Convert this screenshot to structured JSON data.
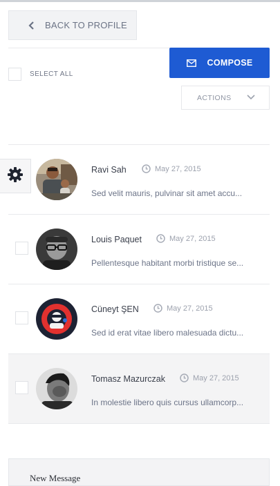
{
  "back": {
    "label": "BACK TO PROFILE",
    "icon": "chevron-left-icon"
  },
  "toolbar": {
    "select_all_label": "SELECT ALL",
    "compose_label": "COMPOSE",
    "compose_icon": "envelope-icon",
    "actions_label": "ACTIONS",
    "accent_color": "#1e5bd3"
  },
  "messages": [
    {
      "name": "Ravi Sah",
      "date": "May 27, 2015",
      "snippet": "Sed velit mauris, pulvinar sit amet accu...",
      "avatar": "photo-man-with-child"
    },
    {
      "name": "Louis Paquet",
      "date": "May 27, 2015",
      "snippet": "Pellentesque habitant morbi tristique se...",
      "avatar": "photo-man-glasses-bw"
    },
    {
      "name": "Cüneyt ŞEN",
      "date": "May 27, 2015",
      "snippet": "Sed id erat vitae libero malesuada dictu...",
      "avatar": "red-circle-logo"
    },
    {
      "name": "Tomasz Mazurczak",
      "date": "May 27, 2015",
      "snippet": "In molestie libero quis cursus ullamcorp...",
      "avatar": "photo-man-bw"
    }
  ],
  "settings_icon": "gear-icon",
  "new_message": {
    "title": "New Message"
  }
}
